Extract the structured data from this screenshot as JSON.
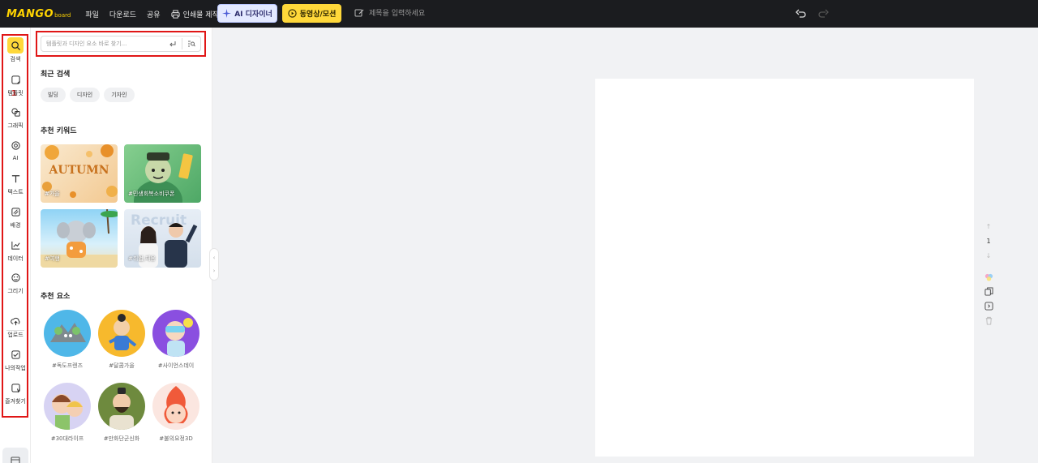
{
  "app": {
    "logo_main": "MANGO",
    "logo_sub": "board"
  },
  "menu": [
    {
      "label": "파일"
    },
    {
      "label": "다운로드"
    },
    {
      "label": "공유"
    },
    {
      "label": "인쇄물 제작"
    }
  ],
  "ai_designer_label": "AI 디자이너",
  "video_motion_label": "동영상/모션",
  "title_placeholder": "제목을 입력하세요",
  "rail": {
    "items": [
      {
        "label": "검색",
        "icon": "search-icon"
      },
      {
        "label": "템플릿",
        "icon": "template-icon"
      },
      {
        "label": "그래픽",
        "icon": "graphic-icon"
      },
      {
        "label": "AI",
        "icon": "ai-icon"
      },
      {
        "label": "텍스트",
        "icon": "text-icon"
      },
      {
        "label": "배경",
        "icon": "background-icon"
      },
      {
        "label": "데이터",
        "icon": "chart-icon"
      },
      {
        "label": "그리기",
        "icon": "draw-icon"
      },
      {
        "label": "업로드",
        "icon": "upload-icon"
      },
      {
        "label": "나의작업",
        "icon": "my-work-icon"
      },
      {
        "label": "즐겨찾기",
        "icon": "favorite-icon"
      }
    ],
    "annotation": "1"
  },
  "panel": {
    "search_placeholder": "템플릿과 디자인 요소 바로 찾기...",
    "recent_title": "최근 검색",
    "recent": [
      "빌딩",
      "디자인",
      "기자인"
    ],
    "keywords_title": "추천 키워드",
    "keywords": [
      "#가을",
      "#민생회복소비쿠폰",
      "#여행",
      "#취업,채용"
    ],
    "autumn_text": "AUTUMN",
    "recruit_text": "Recruit",
    "elements_title": "추천 요소",
    "elements": [
      "#독도프렌즈",
      "#달콤가을",
      "#사이언스데이",
      "#30대라이프",
      "#만화단군신화",
      "#불의요정3D"
    ]
  },
  "page_nav": {
    "current": "1"
  },
  "colors": {
    "accent": "#ffd83a",
    "highlight_box": "#e01616",
    "topbar": "#1b1c1f"
  }
}
